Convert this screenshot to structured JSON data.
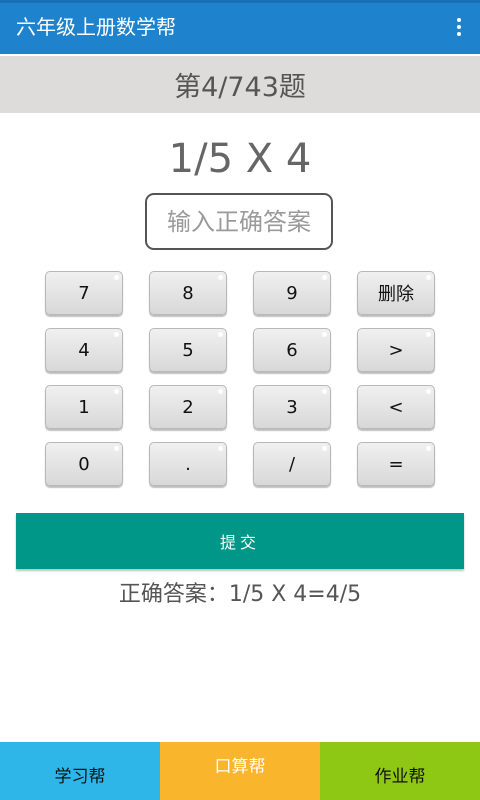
{
  "app_bar": {
    "title": "六年级上册数学帮",
    "overflow_icon": "more-vert-icon"
  },
  "question": {
    "counter": "第4/743题",
    "problem": "1/5 X 4"
  },
  "answer_input": {
    "value": "",
    "placeholder": "输入正确答案"
  },
  "keypad": {
    "keys": [
      "7",
      "8",
      "9",
      "删除",
      "4",
      "5",
      "6",
      ">",
      "1",
      "2",
      "3",
      "<",
      "0",
      ".",
      "/",
      "="
    ]
  },
  "submit": {
    "label": "提交"
  },
  "result": {
    "correct_answer": "正确答案：1/5 X 4=4/5"
  },
  "bottom_nav": {
    "tabs": [
      {
        "label": "学习帮",
        "color": "#2fb6e8",
        "active": false
      },
      {
        "label": "口算帮",
        "color": "#f9b52b",
        "active": true
      },
      {
        "label": "作业帮",
        "color": "#8fc814",
        "active": false
      }
    ]
  },
  "colors": {
    "app_bar": "#1f82cc",
    "question_bar": "#dedcdb",
    "submit_button": "#009688"
  }
}
